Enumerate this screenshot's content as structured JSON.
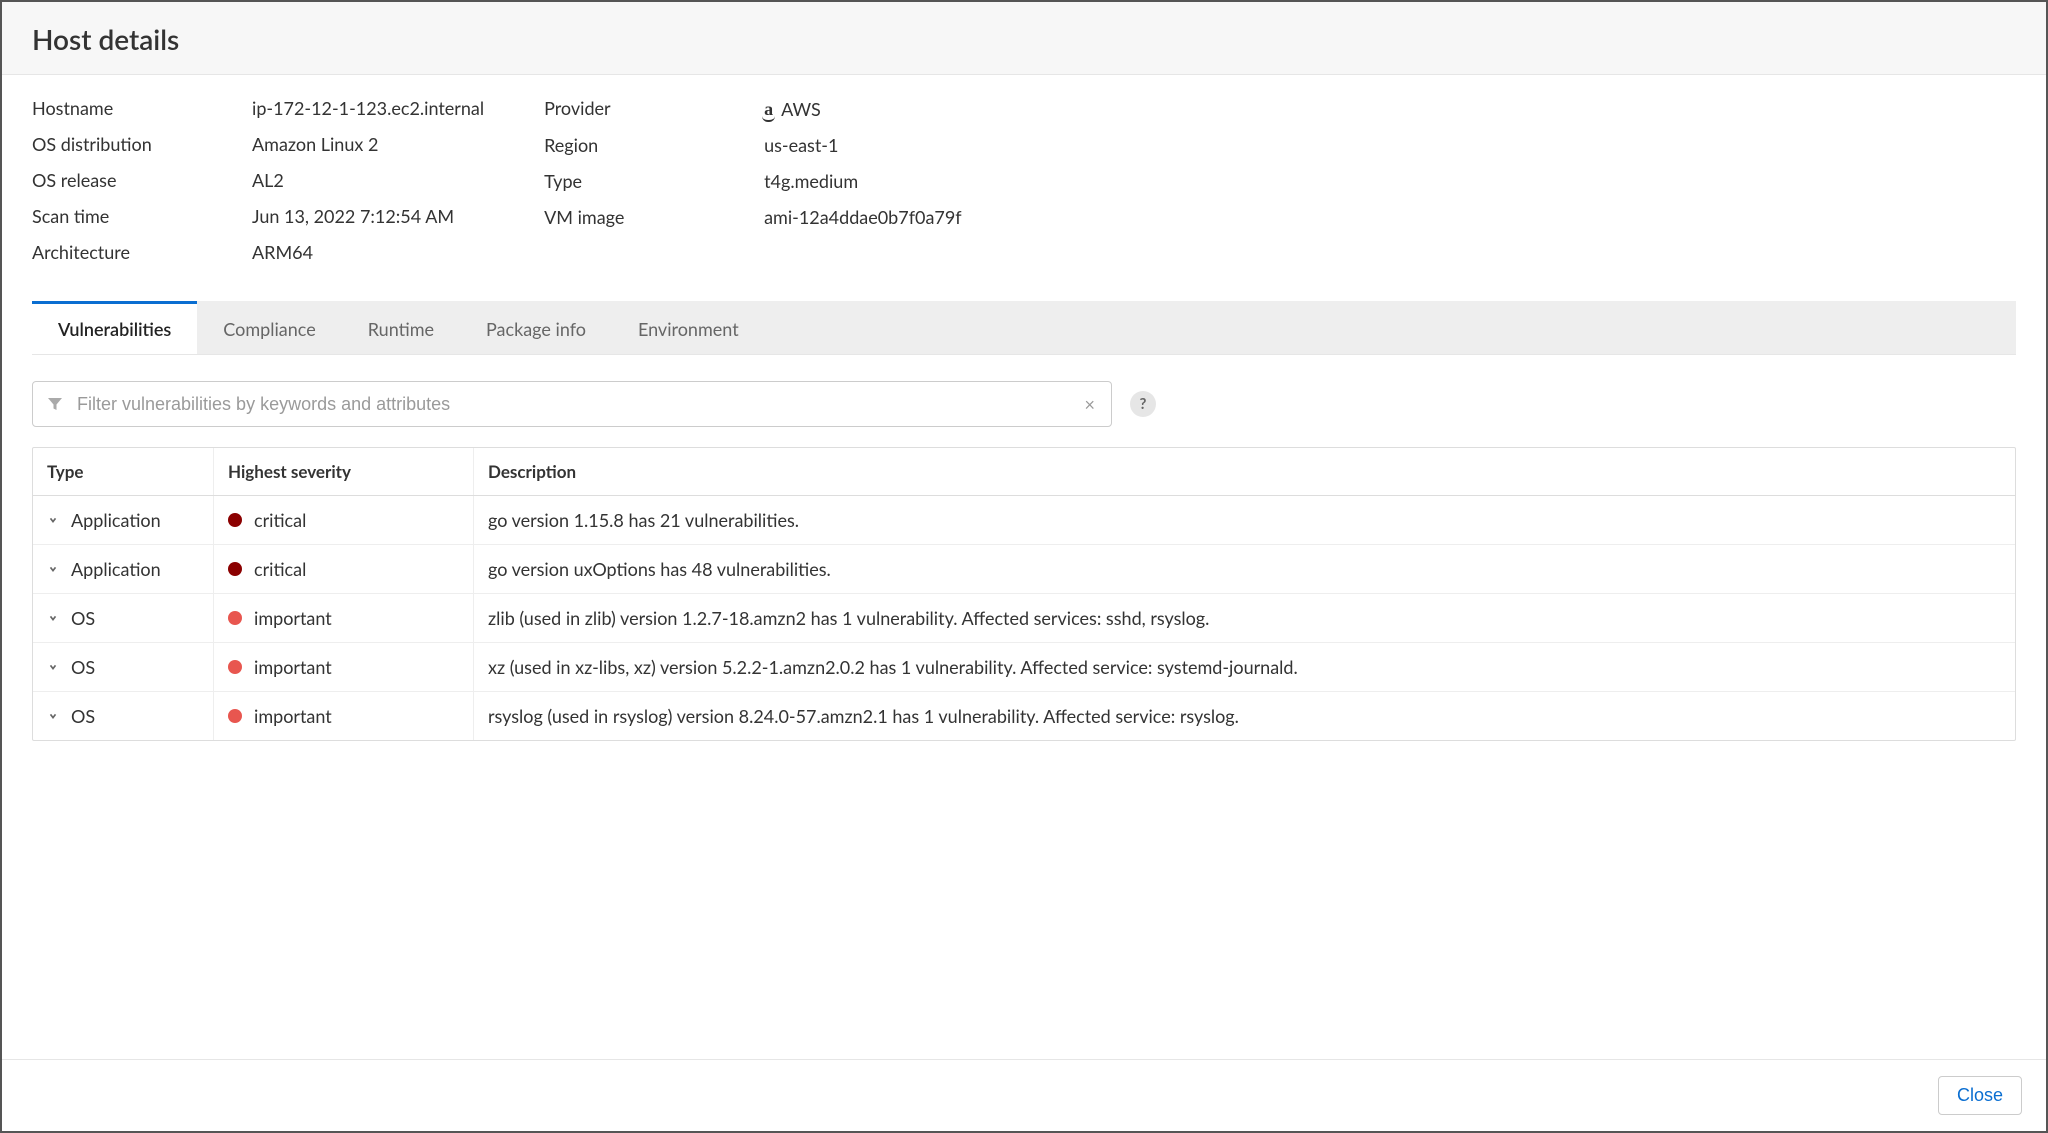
{
  "title": "Host details",
  "meta_left": [
    {
      "label": "Hostname",
      "value": "ip-172-12-1-123.ec2.internal"
    },
    {
      "label": "OS distribution",
      "value": "Amazon Linux 2"
    },
    {
      "label": "OS release",
      "value": "AL2"
    },
    {
      "label": "Scan time",
      "value": "Jun 13, 2022 7:12:54 AM"
    },
    {
      "label": "Architecture",
      "value": "ARM64"
    }
  ],
  "meta_right": [
    {
      "label": "Provider",
      "value": "AWS",
      "icon": "aws"
    },
    {
      "label": "Region",
      "value": "us-east-1"
    },
    {
      "label": "Type",
      "value": "t4g.medium"
    },
    {
      "label": "VM image",
      "value": "ami-12a4ddae0b7f0a79f"
    }
  ],
  "tabs": [
    {
      "label": "Vulnerabilities",
      "active": true
    },
    {
      "label": "Compliance",
      "active": false
    },
    {
      "label": "Runtime",
      "active": false
    },
    {
      "label": "Package info",
      "active": false
    },
    {
      "label": "Environment",
      "active": false
    }
  ],
  "filter": {
    "placeholder": "Filter vulnerabilities by keywords and attributes",
    "value": ""
  },
  "columns": [
    "Type",
    "Highest severity",
    "Description"
  ],
  "severity_colors": {
    "critical": "#8b0000",
    "important": "#e8564f"
  },
  "rows": [
    {
      "type": "Application",
      "severity": "critical",
      "description": "go version 1.15.8 has 21 vulnerabilities."
    },
    {
      "type": "Application",
      "severity": "critical",
      "description": "go version uxOptions has 48 vulnerabilities."
    },
    {
      "type": "OS",
      "severity": "important",
      "description": "zlib (used in zlib) version 1.2.7-18.amzn2 has 1 vulnerability. Affected services: sshd, rsyslog."
    },
    {
      "type": "OS",
      "severity": "important",
      "description": "xz (used in xz-libs, xz) version 5.2.2-1.amzn2.0.2 has 1 vulnerability. Affected service: systemd-journald."
    },
    {
      "type": "OS",
      "severity": "important",
      "description": "rsyslog (used in rsyslog) version 8.24.0-57.amzn2.1 has 1 vulnerability. Affected service: rsyslog."
    }
  ],
  "close_label": "Close",
  "help_glyph": "?"
}
